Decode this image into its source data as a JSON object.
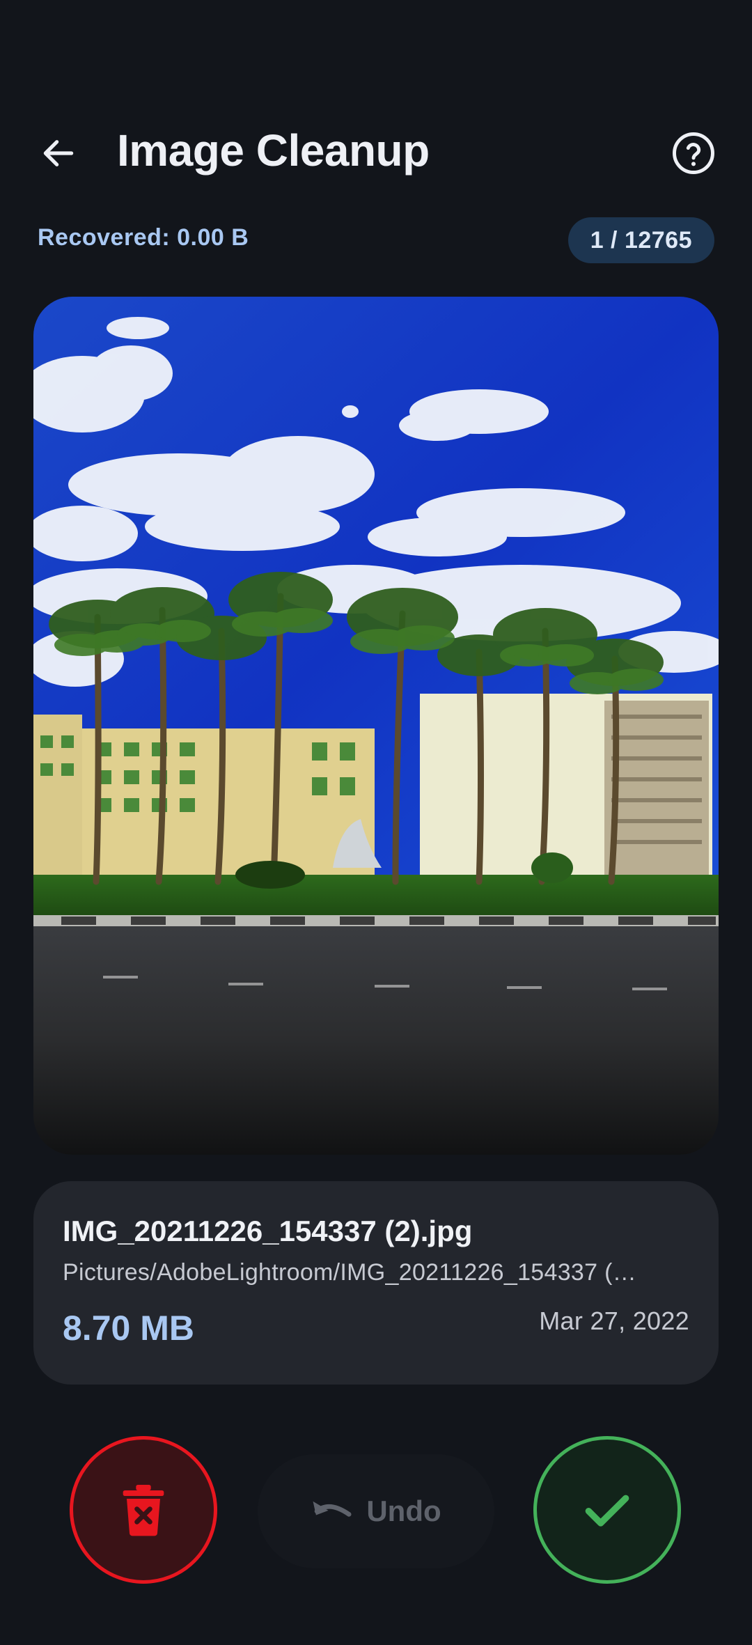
{
  "header": {
    "title": "Image Cleanup",
    "back_icon": "arrow-left-icon",
    "help_icon": "help-circle-icon"
  },
  "status": {
    "recovered": "Recovered: 0.00 B",
    "counter": "1 / 12765"
  },
  "image": {
    "description_icon": "photo-preview"
  },
  "file": {
    "name": "IMG_20211226_154337 (2).jpg",
    "path": "Pictures/AdobeLightroom/IMG_20211226_154337 (…",
    "size": "8.70 MB",
    "date": "Mar 27, 2022"
  },
  "actions": {
    "delete_icon": "trash-x-icon",
    "undo_label": "Undo",
    "undo_icon": "undo-arrow-icon",
    "keep_icon": "checkmark-icon"
  },
  "colors": {
    "background": "#12151b",
    "accent_blue": "#a9c8f2",
    "delete_red": "#e8161f",
    "keep_green": "#44b25a",
    "card": "#23262d"
  }
}
